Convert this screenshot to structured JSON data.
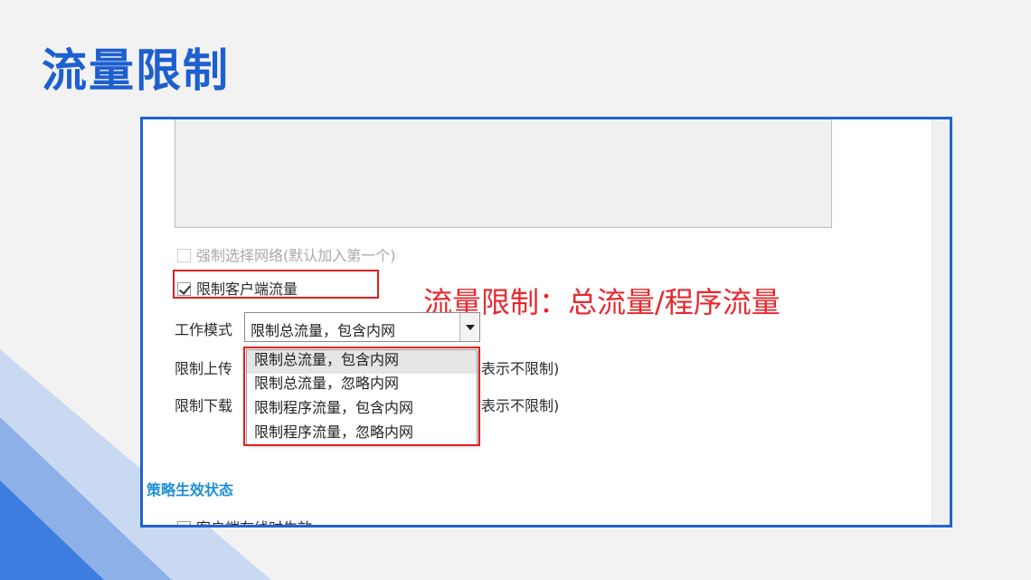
{
  "slide": {
    "title": "流量限制",
    "annotation": "流量限制：总流量/程序流量"
  },
  "form": {
    "force_network_label": "强制选择网络(默认加入第一个)",
    "force_network_checked": false,
    "limit_client_label": "限制客户端流量",
    "limit_client_checked": true,
    "work_mode_label": "工作模式",
    "work_mode_value": "限制总流量，包含内网",
    "upload_label": "限制上传",
    "upload_suffix": "表示不限制)",
    "download_label": "限制下载",
    "download_suffix": "表示不限制)",
    "dropdown_options": [
      "限制总流量，包含内网",
      "限制总流量，忽略内网",
      "限制程序流量，包含内网",
      "限制程序流量，忽略内网"
    ],
    "policy_section_title": "策略生效状态",
    "policy_partial_label": "客户端在线时生效"
  },
  "colors": {
    "title_blue": "#1d5fd0",
    "frame_blue": "#1e64d6",
    "highlight_red": "#e02020",
    "section_blue": "#1e90d8"
  }
}
